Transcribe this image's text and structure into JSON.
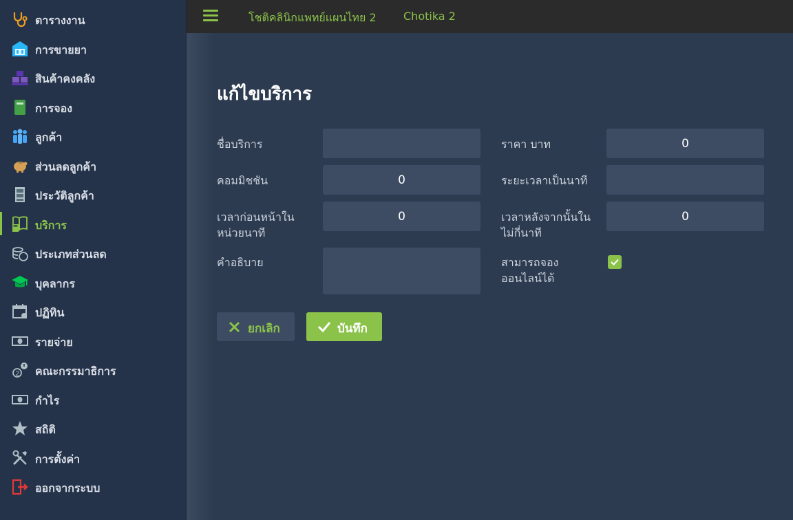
{
  "sidebar": {
    "items": [
      {
        "label": "ตารางงาน",
        "icon": "stethoscope-icon"
      },
      {
        "label": "การขายยา",
        "icon": "pharmacy-icon"
      },
      {
        "label": "สินค้าคงคลัง",
        "icon": "boxes-icon"
      },
      {
        "label": "การจอง",
        "icon": "notebook-icon"
      },
      {
        "label": "ลูกค้า",
        "icon": "people-icon"
      },
      {
        "label": "ส่วนลดลูกค้า",
        "icon": "piggy-bank-icon"
      },
      {
        "label": "ประวัติลูกค้า",
        "icon": "file-cabinet-icon"
      },
      {
        "label": "บริการ",
        "icon": "book-calculator-icon"
      },
      {
        "label": "ประเภทส่วนลด",
        "icon": "coins-icon"
      },
      {
        "label": "บุคลากร",
        "icon": "graduation-cap-icon"
      },
      {
        "label": "ปฏิทิน",
        "icon": "calendar-icon"
      },
      {
        "label": "รายจ่าย",
        "icon": "cash-icon"
      },
      {
        "label": "คณะกรรมาธิการ",
        "icon": "commission-icon"
      },
      {
        "label": "กำไร",
        "icon": "money-icon"
      },
      {
        "label": "สถิติ",
        "icon": "star-icon"
      },
      {
        "label": "การตั้งค่า",
        "icon": "tools-icon"
      },
      {
        "label": "ออกจากระบบ",
        "icon": "logout-icon"
      }
    ],
    "active_index": 7
  },
  "topbar": {
    "clinic_name": "โชติคลินิกแพทย์แผนไทย 2",
    "user_name": "Chotika 2"
  },
  "form": {
    "title": "แก้ไขบริการ",
    "service_name_label": "ชื่อบริการ",
    "service_name_value": "",
    "price_label": "ราคา บาท",
    "price_value": "0",
    "commission_label": "คอมมิชชัน",
    "commission_value": "0",
    "duration_label": "ระยะเวลาเป็นนาที",
    "duration_value": "",
    "before_label": "เวลาก่อนหน้าในหน่วยนาที",
    "before_label_line1": "เวลาก่อนหน้าใน",
    "before_label_line2": "หน่วยนาที",
    "before_value": "0",
    "after_label_line1": "เวลาหลังจากนั้นใน",
    "after_label_line2": "ไม่กี่นาที",
    "after_value": "0",
    "description_label": "คำอธิบาย",
    "description_value": "",
    "online_label_line1": "สามารถจอง",
    "online_label_line2": "ออนไลน์ได้",
    "online_checked": true
  },
  "buttons": {
    "cancel_label": "ยกเลิก",
    "save_label": "บันทึก"
  },
  "colors": {
    "accent": "#8bc34a",
    "sidebar_bg": "#24324a",
    "content_bg": "#2d3b50",
    "input_bg": "#3e4c63",
    "topbar_bg": "#2b2b2b"
  }
}
